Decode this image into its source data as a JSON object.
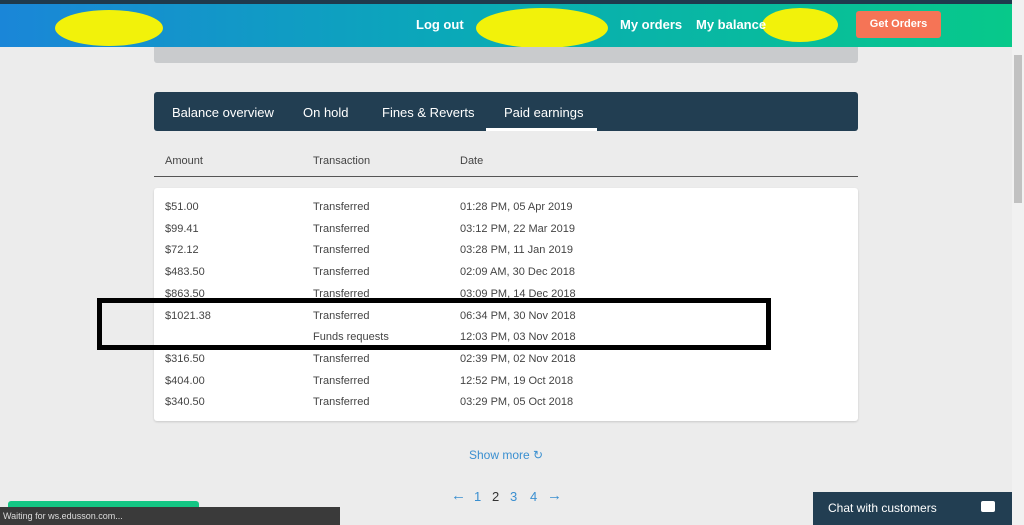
{
  "nav": {
    "logout": "Log out",
    "my_orders": "My orders",
    "my_balance": "My balance",
    "get_orders": "Get Orders"
  },
  "tabs": [
    {
      "label": "Balance overview"
    },
    {
      "label": "On hold"
    },
    {
      "label": "Fines & Reverts"
    },
    {
      "label": "Paid earnings",
      "active": true
    }
  ],
  "table": {
    "headers": [
      "Amount",
      "Transaction",
      "Date"
    ],
    "rows": [
      [
        "$51.00",
        "Transferred",
        "01:28 PM, 05 Apr 2019"
      ],
      [
        "$99.41",
        "Transferred",
        "03:12 PM, 22 Mar 2019"
      ],
      [
        "$72.12",
        "Transferred",
        "03:28 PM, 11 Jan 2019"
      ],
      [
        "$483.50",
        "Transferred",
        "02:09 AM, 30 Dec 2018"
      ],
      [
        "$863.50",
        "Transferred",
        "03:09 PM, 14 Dec 2018"
      ],
      [
        "$1021.38",
        "Transferred",
        "06:34 PM, 30 Nov 2018"
      ],
      [
        "",
        "Funds requests",
        "12:03 PM, 03 Nov 2018"
      ],
      [
        "$316.50",
        "Transferred",
        "02:39 PM, 02 Nov 2018"
      ],
      [
        "$404.00",
        "Transferred",
        "12:52 PM, 19 Oct 2018"
      ],
      [
        "$340.50",
        "Transferred",
        "03:29 PM, 05 Oct 2018"
      ]
    ]
  },
  "show_more": "Show more ↻",
  "pagination": {
    "prev": "←",
    "pages": [
      "1",
      "2",
      "3",
      "4"
    ],
    "current": "2",
    "next": "→"
  },
  "status_bar": "Waiting for ws.edusson.com...",
  "chat": {
    "label": "Chat with customers",
    "icon": "chat-bubble-icon"
  },
  "colors": {
    "tabs_bg": "#223e52",
    "accent": "#f57456",
    "link": "#3a8fd0"
  }
}
